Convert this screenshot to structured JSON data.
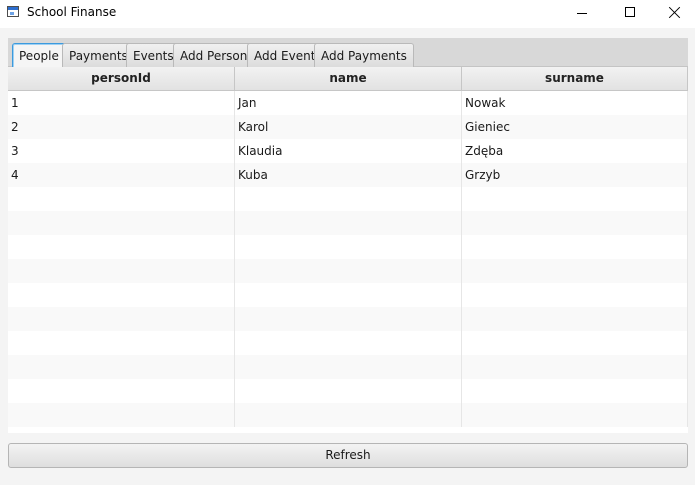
{
  "window": {
    "title": "School Finanse"
  },
  "tabs": [
    {
      "label": "People",
      "selected": true
    },
    {
      "label": "Payments",
      "selected": false
    },
    {
      "label": "Events",
      "selected": false
    },
    {
      "label": "Add Person",
      "selected": false
    },
    {
      "label": "Add Event",
      "selected": false
    },
    {
      "label": "Add Payments",
      "selected": false
    }
  ],
  "table": {
    "columns": [
      "personId",
      "name",
      "surname"
    ],
    "rows": [
      [
        "1",
        "Jan",
        "Nowak"
      ],
      [
        "2",
        "Karol",
        "Gieniec"
      ],
      [
        "3",
        "Klaudia",
        "Zdęba"
      ],
      [
        "4",
        "Kuba",
        "Grzyb"
      ]
    ],
    "empty_rows": 10
  },
  "actions": {
    "refresh_label": "Refresh"
  },
  "colors": {
    "selected_tab_border": "#3b9ade",
    "titlebar_bg": "#ffffff",
    "window_bg": "#f4f4f4"
  }
}
